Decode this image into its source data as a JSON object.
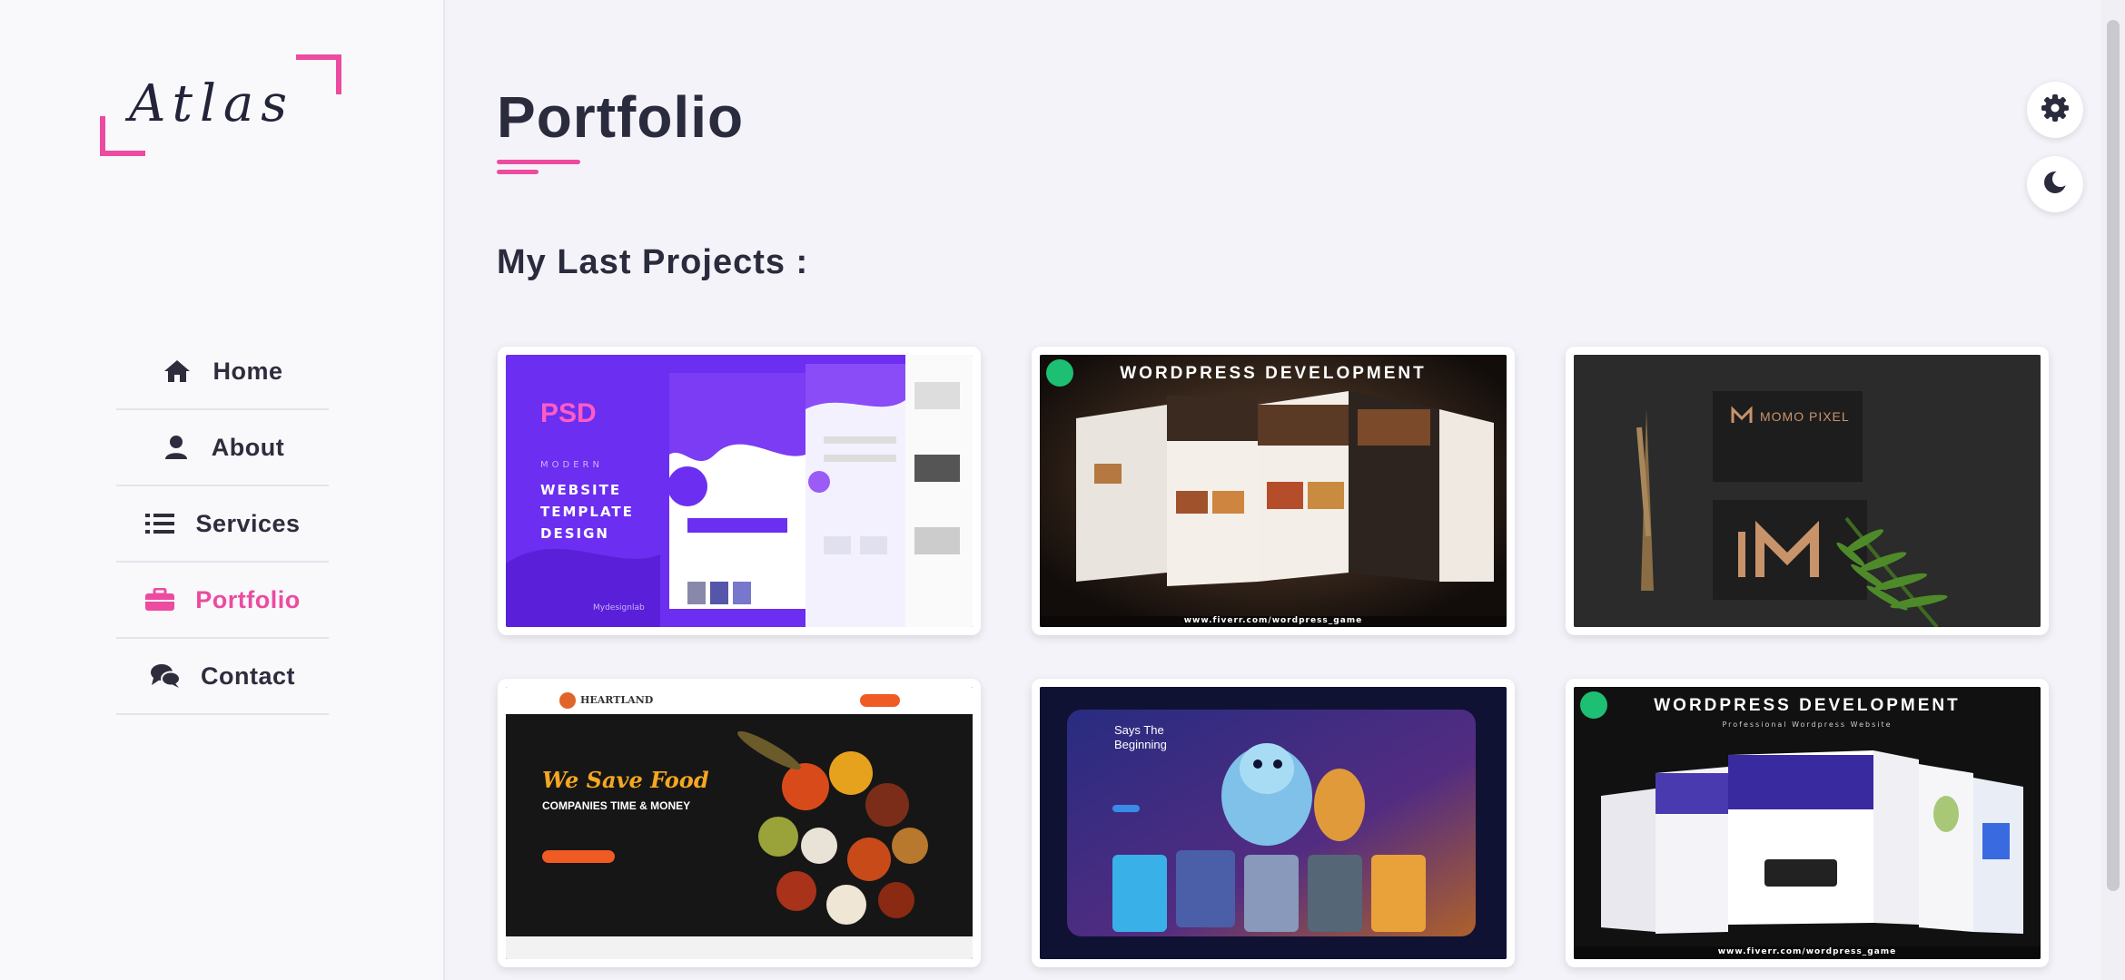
{
  "logo": {
    "text": "Atlas"
  },
  "nav": {
    "items": [
      {
        "label": "Home",
        "icon": "home-icon"
      },
      {
        "label": "About",
        "icon": "user-icon"
      },
      {
        "label": "Services",
        "icon": "list-icon"
      },
      {
        "label": "Portfolio",
        "icon": "briefcase-icon",
        "active": true
      },
      {
        "label": "Contact",
        "icon": "comments-icon"
      }
    ]
  },
  "page": {
    "title": "Portfolio",
    "subtitle": "My Last Projects :"
  },
  "projects": [
    {
      "name": "psd-template",
      "heading": "PSD",
      "lines": [
        "MODERN",
        "WEBSITE",
        "TEMPLATE",
        "DESIGN"
      ],
      "footer": "Mydesignlab"
    },
    {
      "name": "wordpress-development",
      "heading": "WORDPRESS DEVELOPMENT",
      "url": "www.fiverr.com/wordpress_game"
    },
    {
      "name": "momo-pixel",
      "heading": "MOMO PIXEL"
    },
    {
      "name": "heartland-food",
      "brand": "HEARTLAND",
      "headline": "We Save Food",
      "sub": "COMPANIES TIME & MONEY"
    },
    {
      "name": "game-ui",
      "headline": "Says The Beginning"
    },
    {
      "name": "wordpress-development-pro",
      "heading": "WORDPRESS DEVELOPMENT",
      "sub": "Professional Wordpress Website",
      "url": "www.fiverr.com/wordpress_game"
    }
  ],
  "colors": {
    "accent": "#ec4ba0",
    "text": "#2b2b3e",
    "background": "#f3f3f9"
  },
  "controls": {
    "settings_icon": "gear-icon",
    "theme_icon": "moon-icon"
  }
}
